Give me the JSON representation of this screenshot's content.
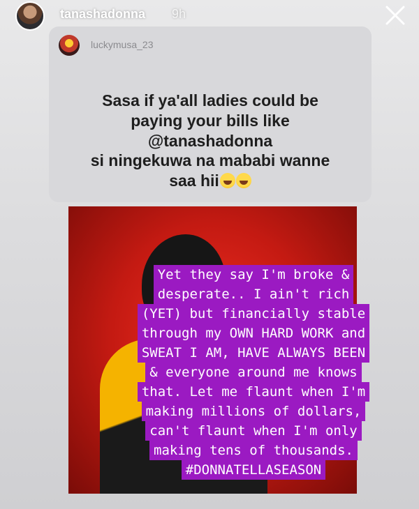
{
  "header": {
    "username": "tanashadonna",
    "time": "9h"
  },
  "repost": {
    "username": "luckymusa_23",
    "caption_lines": [
      "Sasa if ya'all ladies could be",
      "paying your bills like",
      "@tanashadonna",
      "si ningekuwa na mababi wanne",
      "saa hii"
    ]
  },
  "overlay_lines": [
    "Yet they say I'm broke &",
    "desperate.. I ain't rich",
    "(YET) but financially stable",
    "through my OWN HARD WORK and",
    "SWEAT I AM, HAVE ALWAYS BEEN",
    "& everyone around me knows",
    "that. Let me flaunt when I'm",
    "making millions of dollars,",
    "can't flaunt when I'm only",
    "making tens of thousands.",
    "#DONNATELLASEASON"
  ],
  "icons": {
    "close": "close-icon",
    "emoji": "laughing-emoji-icon"
  }
}
